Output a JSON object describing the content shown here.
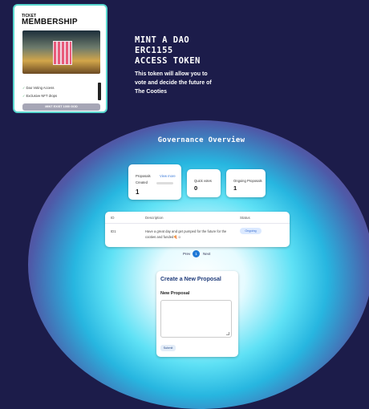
{
  "ticket": {
    "kicker": "TICKET",
    "title": "MEMBERSHIP",
    "features": [
      "Dao Voting Access",
      "Exclusive NFT drops"
    ],
    "mint_label": "MINT EXIST 1000 GOD"
  },
  "hero": {
    "title_lines": [
      "MINT A DAO",
      "ERC1155",
      "ACCESS TOKEN"
    ],
    "subtitle": "This token will allow you to vote and decide the future of The Cooties"
  },
  "governance": {
    "title": "Governance Overview",
    "proposals_label": "Proposals",
    "view_all_label": "View more",
    "created_label": "Created",
    "created_count": "1",
    "quick_votes_label": "Quick votes",
    "quick_votes_count": "0",
    "ongoing_label": "Ongoing Proposals",
    "ongoing_count": "1"
  },
  "table": {
    "headers": [
      "ID",
      "Description",
      "Status"
    ],
    "rows": [
      {
        "id": "ID1",
        "description": "Have a great day and get pumped for the future for the cooties and funded🍕☺",
        "status": "Ongoing"
      }
    ]
  },
  "pagination": {
    "prev": "Prev",
    "current": "1",
    "next": "Next"
  },
  "form": {
    "title": "Create a New Proposal",
    "label": "New Proposal",
    "submit": "Submit"
  }
}
